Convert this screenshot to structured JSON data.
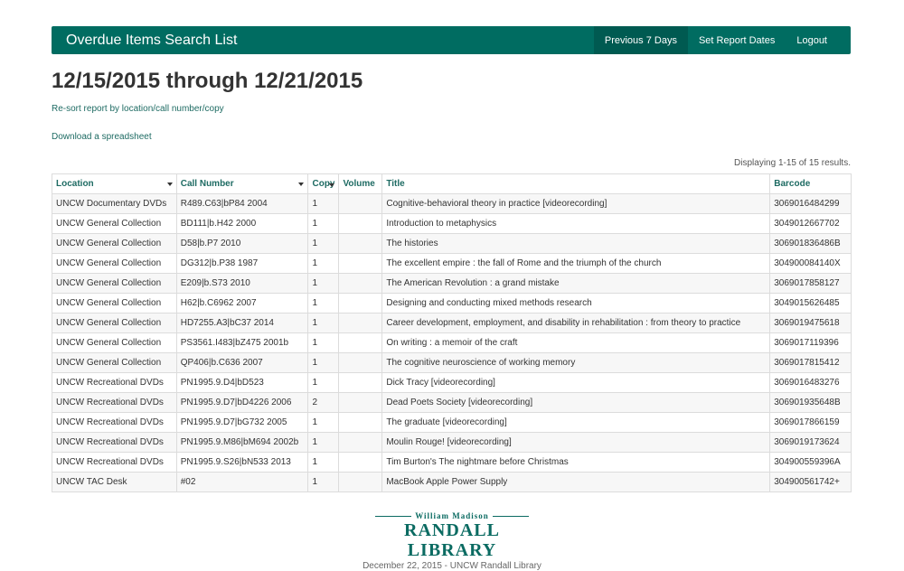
{
  "navbar": {
    "brand": "Overdue Items Search List",
    "links": [
      "Previous 7 Days",
      "Set Report Dates",
      "Logout"
    ]
  },
  "page": {
    "title": "12/15/2015 through 12/21/2015",
    "resort_link": "Re-sort report by location/call number/copy",
    "download_link": "Download a spreadsheet",
    "results_count": "Displaying 1-15 of 15 results."
  },
  "table": {
    "headers": [
      "Location",
      "Call Number",
      "Copy",
      "Volume",
      "Title",
      "Barcode"
    ],
    "rows": [
      [
        "UNCW Documentary DVDs",
        "R489.C63|bP84 2004",
        "1",
        "",
        "Cognitive-behavioral theory in practice [videorecording]",
        "3069016484299"
      ],
      [
        "UNCW General Collection",
        "BD111|b.H42 2000",
        "1",
        "",
        "Introduction to metaphysics",
        "3049012667702"
      ],
      [
        "UNCW General Collection",
        "D58|b.P7 2010",
        "1",
        "",
        "The histories",
        "306901836486B"
      ],
      [
        "UNCW General Collection",
        "DG312|b.P38 1987",
        "1",
        "",
        "The excellent empire : the fall of Rome and the triumph of the church",
        "304900084140X"
      ],
      [
        "UNCW General Collection",
        "E209|b.S73 2010",
        "1",
        "",
        "The American Revolution : a grand mistake",
        "3069017858127"
      ],
      [
        "UNCW General Collection",
        "H62|b.C6962 2007",
        "1",
        "",
        "Designing and conducting mixed methods research",
        "3049015626485"
      ],
      [
        "UNCW General Collection",
        "HD7255.A3|bC37 2014",
        "1",
        "",
        "Career development, employment, and disability in rehabilitation : from theory to practice",
        "3069019475618"
      ],
      [
        "UNCW General Collection",
        "PS3561.I483|bZ475 2001b",
        "1",
        "",
        "On writing : a memoir of the craft",
        "3069017119396"
      ],
      [
        "UNCW General Collection",
        "QP406|b.C636 2007",
        "1",
        "",
        "The cognitive neuroscience of working memory",
        "3069017815412"
      ],
      [
        "UNCW Recreational DVDs",
        "PN1995.9.D4|bD523",
        "1",
        "",
        "Dick Tracy [videorecording]",
        "3069016483276"
      ],
      [
        "UNCW Recreational DVDs",
        "PN1995.9.D7|bD4226 2006",
        "2",
        "",
        "Dead Poets Society [videorecording]",
        "306901935648B"
      ],
      [
        "UNCW Recreational DVDs",
        "PN1995.9.D7|bG732 2005",
        "1",
        "",
        "The graduate [videorecording]",
        "3069017866159"
      ],
      [
        "UNCW Recreational DVDs",
        "PN1995.9.M86|bM694 2002b",
        "1",
        "",
        "Moulin Rouge! [videorecording]",
        "3069019173624"
      ],
      [
        "UNCW Recreational DVDs",
        "PN1995.9.S26|bN533 2013",
        "1",
        "",
        "Tim Burton's The nightmare before Christmas",
        "304900559396A"
      ],
      [
        "UNCW TAC Desk",
        "#02",
        "1",
        "",
        "MacBook Apple Power Supply",
        "304900561742+"
      ]
    ]
  },
  "footer": {
    "logo_top": "William Madison",
    "logo_main": "RANDALL LIBRARY",
    "text": "December 22, 2015 - UNCW Randall Library"
  },
  "colors": {
    "navbar": "#006c61",
    "link": "#1e6b63"
  }
}
